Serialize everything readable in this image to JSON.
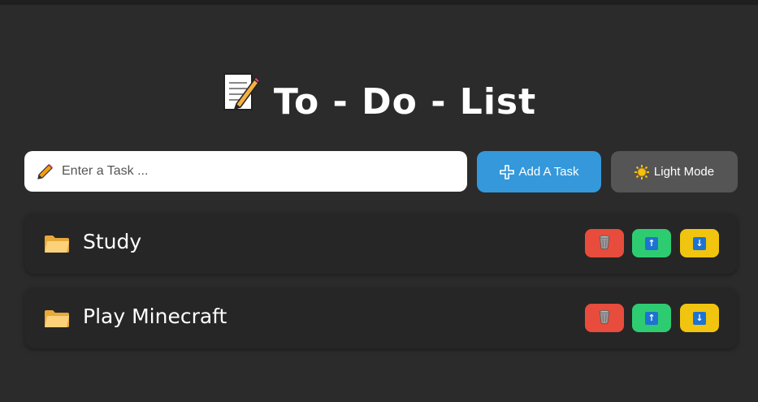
{
  "header": {
    "title": "To - Do - List",
    "title_icon": "memo-icon"
  },
  "task_input": {
    "placeholder": "Enter a Task ...",
    "value": "",
    "icon": "pencil-icon"
  },
  "toolbar": {
    "add_label": "Add A Task",
    "add_icon": "plus-icon",
    "mode_label": "Light Mode",
    "mode_icon": "sun-icon"
  },
  "tasks": [
    {
      "label": "Study",
      "icon": "folder-icon"
    },
    {
      "label": "Play Minecraft",
      "icon": "folder-icon"
    }
  ],
  "task_actions": {
    "delete_icon": "trash-icon",
    "up_icon": "arrow-up-icon",
    "down_icon": "arrow-down-icon",
    "up_glyph": "↑",
    "down_glyph": "↓"
  },
  "colors": {
    "background": "#2b2b2b",
    "task_bg": "#262626",
    "add_button": "#3498db",
    "mode_button": "#555555",
    "delete_button": "#e74c3c",
    "up_button": "#2ecc71",
    "down_button": "#f1c40f"
  }
}
